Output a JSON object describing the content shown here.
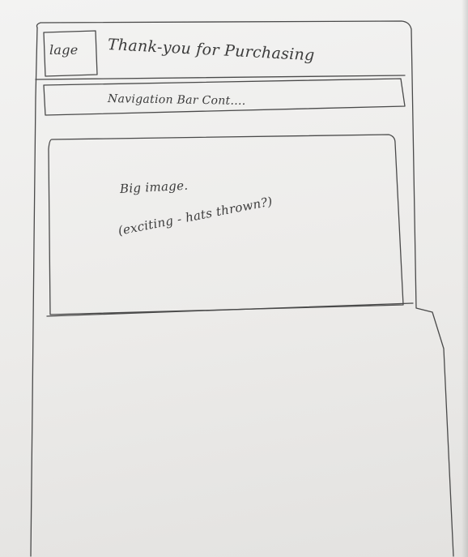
{
  "header": {
    "logo_label": "lage",
    "title": "Thank-you for Purchasing"
  },
  "nav": {
    "label": "Navigation Bar Cont...."
  },
  "hero": {
    "line1": "Big image.",
    "line2": "(exciting - hats thrown?)"
  }
}
